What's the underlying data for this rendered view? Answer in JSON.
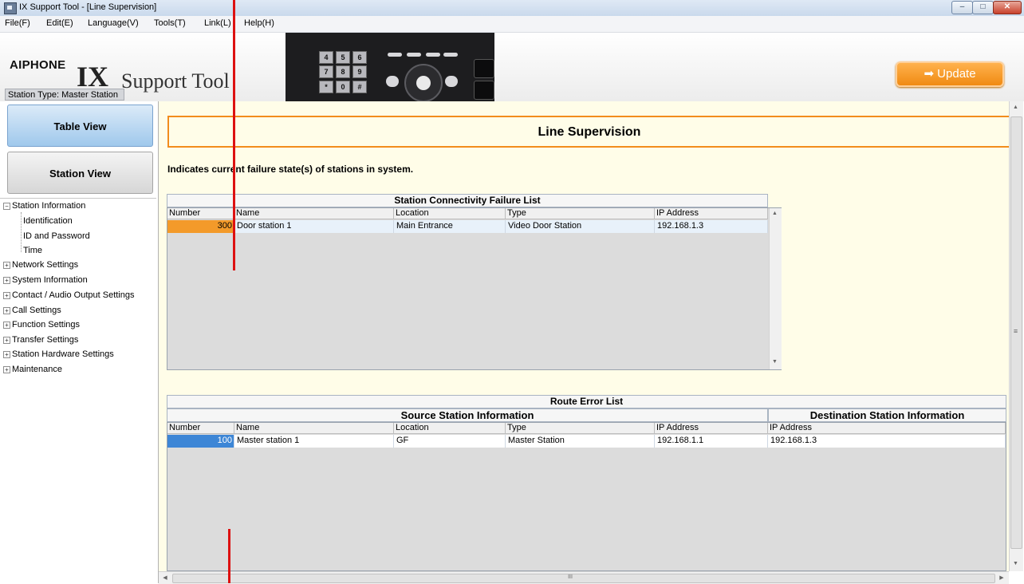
{
  "window": {
    "title": "IX Support Tool - [Line Supervision]",
    "min_label": "–",
    "max_label": "□",
    "close_label": "✕"
  },
  "menu": [
    "File(F)",
    "Edit(E)",
    "Language(V)",
    "Tools(T)",
    "Link(L)",
    "Help(H)"
  ],
  "banner": {
    "brand": "AIPHONE",
    "product_ix": "IX",
    "product_rest": "Support Tool",
    "station_type": "Station Type:  Master Station",
    "update_label": "➡ Update",
    "keypad": [
      "4",
      "5",
      "6",
      "7",
      "8",
      "9",
      "*",
      "0",
      "#"
    ]
  },
  "nav": {
    "table_view": "Table View",
    "station_view": "Station View"
  },
  "tree": {
    "station_information": "Station Information",
    "children": [
      "Identification",
      "ID and Password",
      "Time"
    ],
    "collapsed": [
      "Network Settings",
      "System Information",
      "Contact / Audio Output Settings",
      "Call Settings",
      "Function Settings",
      "Transfer Settings",
      "Station Hardware Settings",
      "Maintenance"
    ],
    "expanded_glyph": "−",
    "collapsed_glyph": "+"
  },
  "page": {
    "title": "Line Supervision",
    "description": "Indicates current failure state(s) of stations in system."
  },
  "connectivity": {
    "title": "Station Connectivity Failure List",
    "headers": [
      "Number",
      "Name",
      "Location",
      "Type",
      "IP Address"
    ],
    "rows": [
      [
        "300",
        "Door station 1",
        "Main Entrance",
        "Video Door Station",
        "192.168.1.3"
      ]
    ]
  },
  "route": {
    "title": "Route Error List",
    "source_group": "Source Station Information",
    "dest_group": "Destination Station Information",
    "headers": [
      "Number",
      "Name",
      "Location",
      "Type",
      "IP Address",
      "IP Address"
    ],
    "rows": [
      [
        "100",
        "Master station 1",
        "GF",
        "Master Station",
        "192.168.1.1",
        "192.168.1.3"
      ]
    ]
  },
  "scroll": {
    "up": "▲",
    "down": "▼",
    "left": "◀",
    "right": "▶",
    "grip_h": "III",
    "grip_v": "≡"
  },
  "colors": {
    "accent_orange": "#f28c1c",
    "selected_blue": "#3d86d6",
    "red_marker": "#dd1111"
  }
}
